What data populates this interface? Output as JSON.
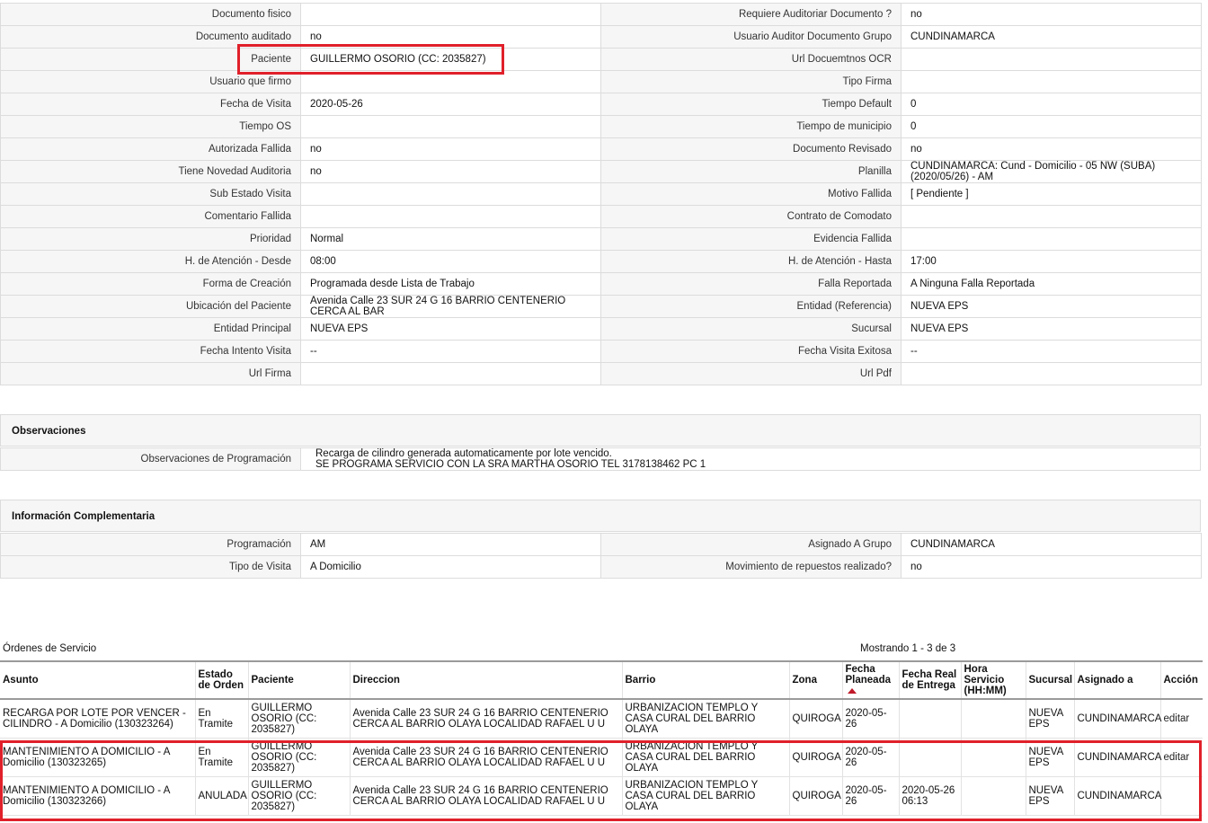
{
  "details": {
    "rows": [
      {
        "l1": "Documento fisico",
        "v1": "",
        "l2": "Requiere Auditoriar Documento ?",
        "v2": "no"
      },
      {
        "l1": "Documento auditado",
        "v1": "no",
        "l2": "Usuario Auditor Documento Grupo",
        "v2": "CUNDINAMARCA"
      },
      {
        "l1": "Paciente",
        "v1": "GUILLERMO OSORIO (CC: 2035827)",
        "l2": "Url Docuemtnos OCR",
        "v2": ""
      },
      {
        "l1": "Usuario que firmo",
        "v1": "",
        "l2": "Tipo Firma",
        "v2": ""
      },
      {
        "l1": "Fecha de Visita",
        "v1": "2020-05-26",
        "l2": "Tiempo Default",
        "v2": "0"
      },
      {
        "l1": "Tiempo OS",
        "v1": "",
        "l2": "Tiempo de municipio",
        "v2": "0"
      },
      {
        "l1": "Autorizada Fallida",
        "v1": "no",
        "l2": "Documento Revisado",
        "v2": "no"
      },
      {
        "l1": "Tiene Novedad Auditoria",
        "v1": "no",
        "l2": "Planilla",
        "v2": "CUNDINAMARCA: Cund - Domicilio - 05 NW (SUBA) (2020/05/26) - AM"
      },
      {
        "l1": "Sub Estado Visita",
        "v1": "",
        "l2": "Motivo Fallida",
        "v2": "[ Pendiente ]"
      },
      {
        "l1": "Comentario Fallida",
        "v1": "",
        "l2": "Contrato de Comodato",
        "v2": ""
      },
      {
        "l1": "Prioridad",
        "v1": "Normal",
        "l2": "Evidencia Fallida",
        "v2": ""
      },
      {
        "l1": "H. de Atención - Desde",
        "v1": "08:00",
        "l2": "H. de Atención - Hasta",
        "v2": "17:00"
      },
      {
        "l1": "Forma de Creación",
        "v1": "Programada desde Lista de Trabajo",
        "l2": "Falla Reportada",
        "v2": "A Ninguna Falla Reportada"
      },
      {
        "l1": "Ubicación del Paciente",
        "v1": "Avenida Calle 23 SUR 24 G 16 BARRIO CENTENERIO CERCA AL BAR",
        "l2": "Entidad (Referencia)",
        "v2": "NUEVA EPS"
      },
      {
        "l1": "Entidad Principal",
        "v1": "NUEVA EPS",
        "l2": "Sucursal",
        "v2": "NUEVA EPS"
      },
      {
        "l1": "Fecha Intento Visita",
        "v1": "--",
        "l2": "Fecha Visita Exitosa",
        "v2": "--"
      },
      {
        "l1": "Url Firma",
        "v1": "",
        "l2": "Url Pdf",
        "v2": ""
      }
    ]
  },
  "observaciones": {
    "title": "Observaciones",
    "label": "Observaciones de Programación",
    "line1": "Recarga de cilindro generada automaticamente por lote vencido.",
    "line2": "SE PROGRAMA SERVICIO CON LA SRA MARTHA OSORIO TEL 3178138462 PC 1"
  },
  "complementaria": {
    "title": "Información Complementaria",
    "rows": [
      {
        "l1": "Programación",
        "v1": "AM",
        "l2": "Asignado A Grupo",
        "v2": "CUNDINAMARCA"
      },
      {
        "l1": "Tipo de Visita",
        "v1": "A Domicilio",
        "l2": "Movimiento de repuestos realizado?",
        "v2": "no"
      }
    ]
  },
  "orders": {
    "title": "Órdenes de Servicio",
    "count": "Mostrando 1 - 3 de 3",
    "columns": [
      "Asunto",
      "Estado de Orden",
      "Paciente",
      "Direccion",
      "Barrio",
      "Zona",
      "Fecha Planeada",
      "Fecha Real de Entrega",
      "Hora Servicio (HH:MM)",
      "Sucursal",
      "Asignado a",
      "Acción"
    ],
    "rows": [
      {
        "asunto": "RECARGA POR LOTE POR VENCER - CILINDRO - A Domicilio (130323264)",
        "estado": "En Tramite",
        "paciente": "GUILLERMO OSORIO (CC: 2035827)",
        "direccion": "Avenida Calle 23 SUR 24 G 16 BARRIO CENTENERIO CERCA AL BARRIO OLAYA LOCALIDAD RAFAEL U U",
        "barrio": "URBANIZACION TEMPLO Y CASA CURAL DEL BARRIO OLAYA",
        "zona": "QUIROGA",
        "fecha_planeada": "2020-05-26",
        "fecha_real": "",
        "hora": "",
        "sucursal": "NUEVA EPS",
        "asignado": "CUNDINAMARCA",
        "accion": "editar"
      },
      {
        "asunto": "MANTENIMIENTO A DOMICILIO - A Domicilio (130323265)",
        "estado": "En Tramite",
        "paciente": "GUILLERMO OSORIO (CC: 2035827)",
        "direccion": "Avenida Calle 23 SUR 24 G 16 BARRIO CENTENERIO CERCA AL BARRIO OLAYA LOCALIDAD RAFAEL U U",
        "barrio": "URBANIZACION TEMPLO Y CASA CURAL DEL BARRIO OLAYA",
        "zona": "QUIROGA",
        "fecha_planeada": "2020-05-26",
        "fecha_real": "",
        "hora": "",
        "sucursal": "NUEVA EPS",
        "asignado": "CUNDINAMARCA",
        "accion": "editar"
      },
      {
        "asunto": "MANTENIMIENTO A DOMICILIO - A Domicilio (130323266)",
        "estado": "ANULADA",
        "paciente": "GUILLERMO OSORIO (CC: 2035827)",
        "direccion": "Avenida Calle 23 SUR 24 G 16 BARRIO CENTENERIO CERCA AL BARRIO OLAYA LOCALIDAD RAFAEL U U",
        "barrio": "URBANIZACION TEMPLO Y CASA CURAL DEL BARRIO OLAYA",
        "zona": "QUIROGA",
        "fecha_planeada": "2020-05-26",
        "fecha_real": "2020-05-26 06:13",
        "hora": "",
        "sucursal": "NUEVA EPS",
        "asignado": "CUNDINAMARCA",
        "accion": ""
      }
    ]
  },
  "colors": {
    "highlight": "#e0202a",
    "sort_arrow": "#c0192a"
  }
}
